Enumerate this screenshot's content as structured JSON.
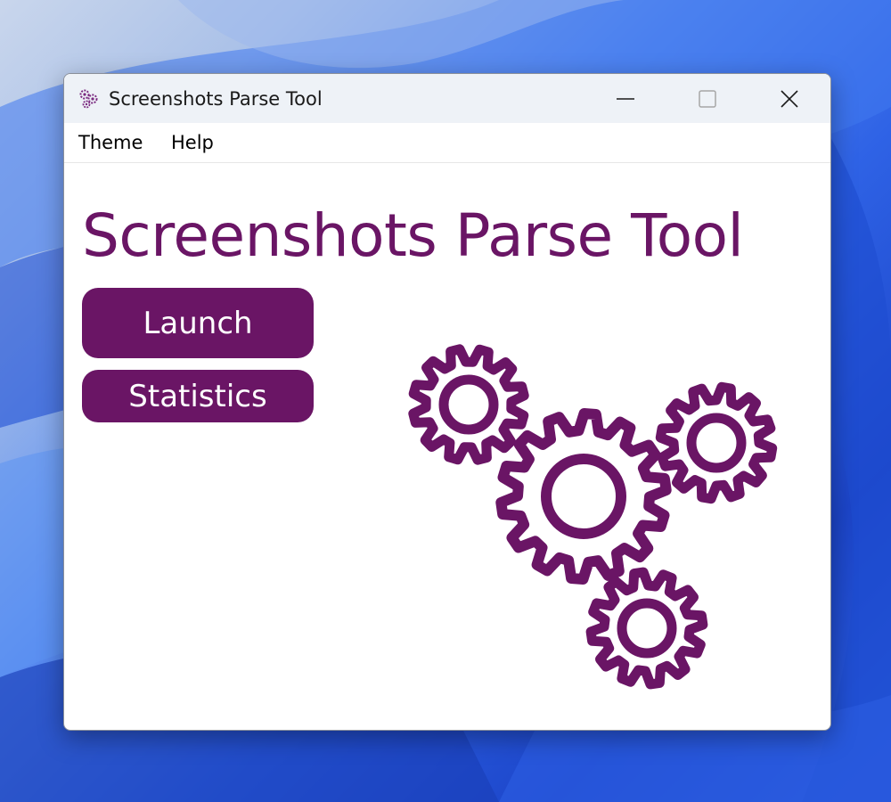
{
  "window": {
    "title": "Screenshots Parse Tool"
  },
  "titlebar_buttons": {
    "minimize_icon": "minimize-icon",
    "maximize_icon": "maximize-icon",
    "close_icon": "close-icon"
  },
  "menu": {
    "items": [
      {
        "label": "Theme"
      },
      {
        "label": "Help"
      }
    ]
  },
  "main": {
    "heading": "Screenshots Parse Tool",
    "buttons": {
      "launch_label": "Launch",
      "statistics_label": "Statistics"
    },
    "illustration": "gears-illustration"
  },
  "colors": {
    "accent": "#6a1565",
    "titlebar_bg": "#eef2f7",
    "button_text": "#ffffff",
    "desktop_blue": "#2f63e6"
  }
}
